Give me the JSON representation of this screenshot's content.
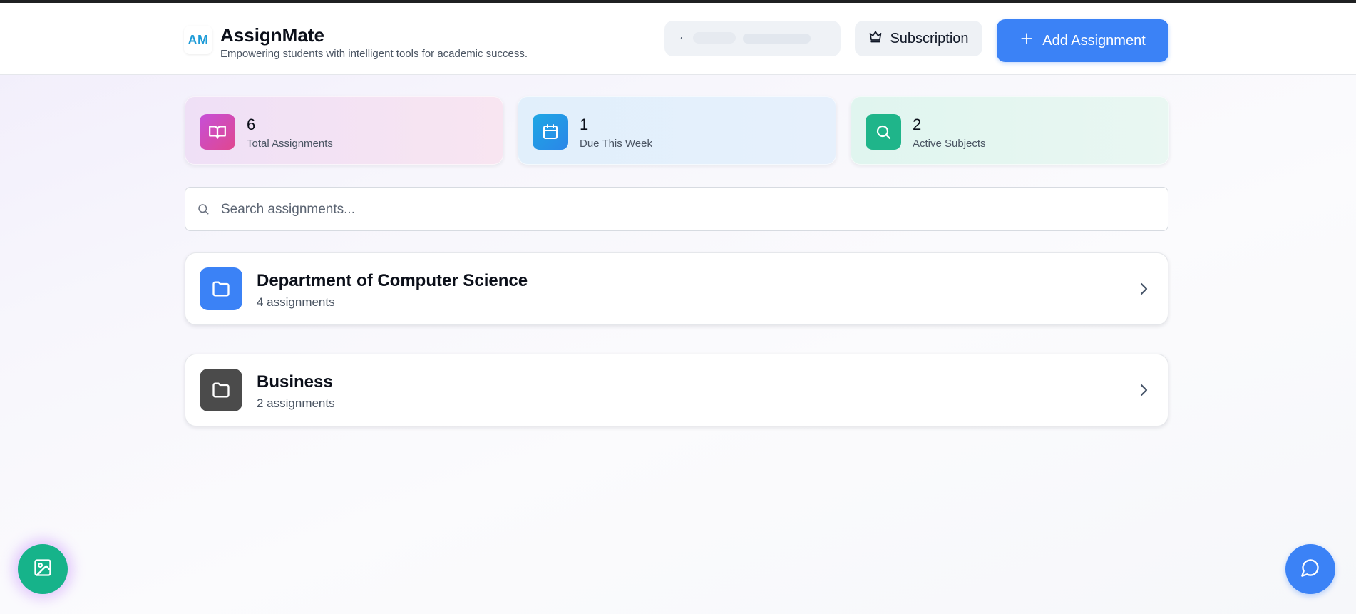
{
  "header": {
    "logo_text": "AM",
    "app_title": "AssignMate",
    "tagline": "Empowering students with intelligent tools for academic success.",
    "user_initial": "ʻ",
    "subscription_label": "Subscription",
    "add_assignment_label": "Add Assignment"
  },
  "stats": [
    {
      "value": "6",
      "label": "Total Assignments",
      "icon": "book-open-icon"
    },
    {
      "value": "1",
      "label": "Due This Week",
      "icon": "calendar-icon"
    },
    {
      "value": "2",
      "label": "Active Subjects",
      "icon": "search-icon"
    }
  ],
  "search": {
    "placeholder": "Search assignments...",
    "value": ""
  },
  "folders": [
    {
      "title": "Department of Computer Science",
      "count": "4 assignments",
      "color": "#3b82f6",
      "icon": "folder-icon"
    },
    {
      "title": "Business",
      "count": "2 assignments",
      "color": "#4b4b4b",
      "icon": "folder-icon"
    }
  ],
  "colors": {
    "primary": "#3b82f6",
    "accent_green": "#16b38a",
    "accent_pink": "#c64fd8"
  },
  "fabs": {
    "left_icon": "image-icon",
    "right_icon": "chat-icon"
  }
}
